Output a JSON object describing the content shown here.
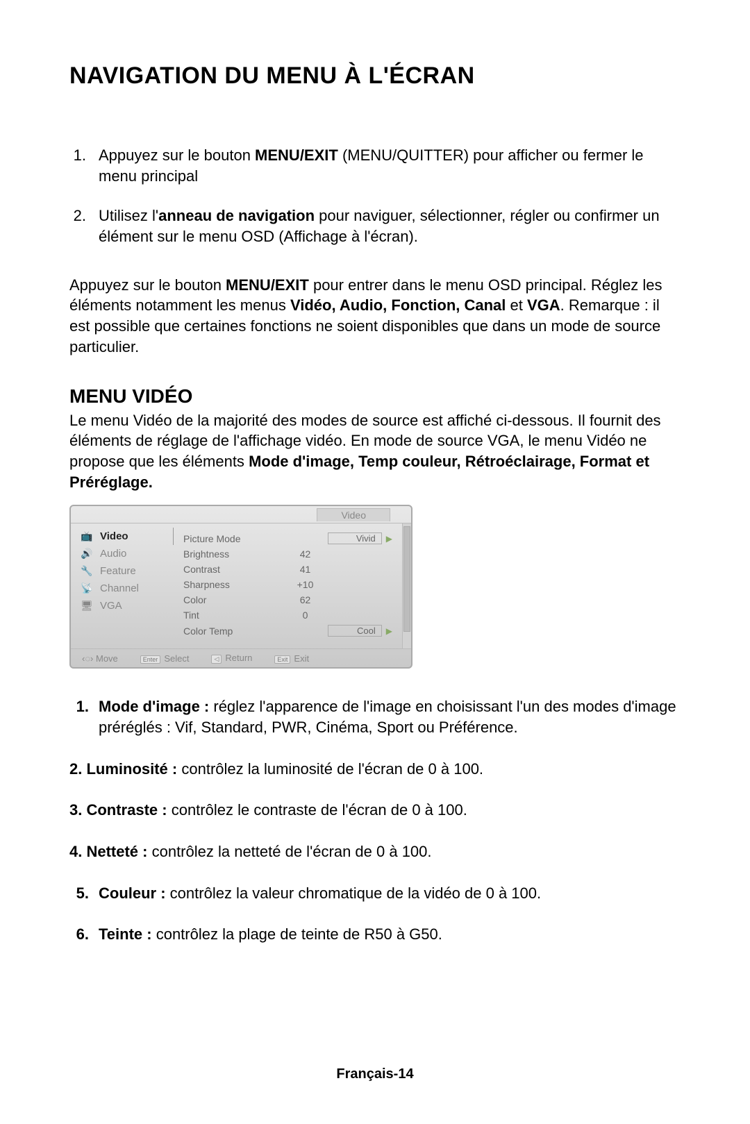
{
  "title": "NAVIGATION DU MENU À L'ÉCRAN",
  "instructions": [
    {
      "num": "1.",
      "pre": "Appuyez sur le bouton ",
      "bold": "MENU/EXIT",
      "post": " (MENU/QUITTER) pour afficher ou fermer le menu principal"
    },
    {
      "num": "2.",
      "pre": "Utilisez l'",
      "bold": "anneau de navigation",
      "post": " pour naviguer, sélectionner, régler ou confirmer un élément sur le menu OSD (Affichage à l'écran)."
    }
  ],
  "osd_note": {
    "pre": "Appuyez sur le bouton ",
    "b1": "MENU/EXIT",
    "mid1": " pour entrer dans le menu OSD principal. Réglez les éléments notamment les menus ",
    "b2": "Vidéo, Audio, Fonction, Canal",
    "mid2": " et ",
    "b3": "VGA",
    "post": ". Remarque : il est possible que certaines fonctions ne soient disponibles que dans un mode de source particulier."
  },
  "section_title": "MENU VIDÉO",
  "section_para": {
    "text": "Le menu Vidéo de la majorité des modes de source est affiché ci-dessous. Il fournit des éléments de réglage de l'affichage vidéo. En mode de source VGA, le menu Vidéo ne propose que les éléments ",
    "bold": "Mode d'image, Temp couleur, Rétroéclairage, Format et Préréglage."
  },
  "osd": {
    "crumb": "Video",
    "tabs": [
      {
        "label": "Video",
        "icon": "tv-icon",
        "active": true
      },
      {
        "label": "Audio",
        "icon": "speaker-icon",
        "active": false
      },
      {
        "label": "Feature",
        "icon": "wrench-icon",
        "active": false
      },
      {
        "label": "Channel",
        "icon": "dish-icon",
        "active": false
      },
      {
        "label": "VGA",
        "icon": "monitor-icon",
        "active": false
      }
    ],
    "rows": [
      {
        "label": "Picture Mode",
        "value": "Vivid",
        "type": "select"
      },
      {
        "label": "Brightness",
        "value": "42",
        "type": "num"
      },
      {
        "label": "Contrast",
        "value": "41",
        "type": "num"
      },
      {
        "label": "Sharpness",
        "value": "+10",
        "type": "num"
      },
      {
        "label": "Color",
        "value": "62",
        "type": "num"
      },
      {
        "label": "Tint",
        "value": "0",
        "type": "num"
      },
      {
        "label": "Color Temp",
        "value": "Cool",
        "type": "select"
      }
    ],
    "footer": {
      "move": "Move",
      "select_btn": "Enter",
      "select": "Select",
      "return_btn": "◁",
      "return": "Return",
      "exit_btn": "Exit",
      "exit": "Exit"
    }
  },
  "definitions_flex": [
    {
      "num": "1.",
      "term": "Mode d'image :",
      "desc": " réglez l'apparence de l'image en choisissant l'un des modes d'image préréglés : Vif, Standard, PWR, Cinéma, Sport ou Préférence."
    }
  ],
  "definitions_inline": [
    {
      "line_bold": "2. Luminosité :",
      "line_rest": " contrôlez la luminosité de l'écran de 0 à 100."
    },
    {
      "line_bold": "3. Contraste :",
      "line_rest": " contrôlez le contraste de l'écran de 0 à 100."
    },
    {
      "line_bold": "4. Netteté :",
      "line_rest": " contrôlez la netteté de l'écran de 0 à 100."
    }
  ],
  "definitions_flex2": [
    {
      "num": "5.",
      "term": "Couleur :",
      "desc": " contrôlez la valeur chromatique de la vidéo de 0 à 100."
    },
    {
      "num": "6.",
      "term": "Teinte :",
      "desc": " contrôlez la plage de teinte de R50 à G50."
    }
  ],
  "page_footer": "Français-14",
  "icon_glyphs": {
    "tv-icon": "📺",
    "speaker-icon": "🔊",
    "wrench-icon": "🔧",
    "dish-icon": "📡",
    "monitor-icon": "🖥"
  }
}
